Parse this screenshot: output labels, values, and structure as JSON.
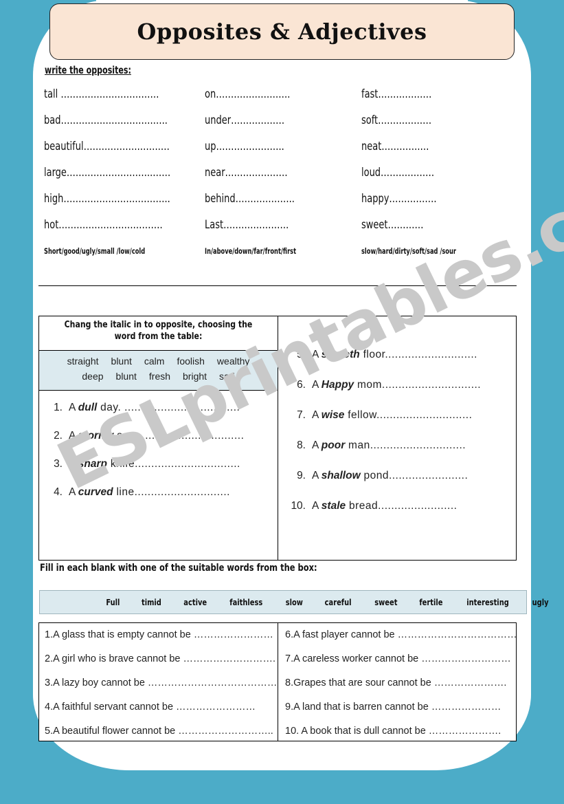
{
  "title": "Opposites & Adjectives",
  "watermark": "ESLprintables.com",
  "colors": {
    "frame": "#4cacc8",
    "title_bg": "#fae5d4",
    "wordbank_bg": "#dceaef",
    "watermark": "#c9c9c9"
  },
  "section1": {
    "heading": "write the opposites:",
    "columns": [
      {
        "items": [
          "tall ……………………………",
          "bad………………………….…..",
          "beautiful……………….…….…",
          "large………………………..……",
          "high…………………….………..",
          "hot…………………….………."
        ],
        "hint": "Short/good/ugly/small /low/cold"
      },
      {
        "items": [
          "on…………………….",
          "under………………",
          "up…………………..",
          "near…………………",
          "behind………………..",
          "Last…………………."
        ],
        "hint": "In/above/down/far/front/first"
      },
      {
        "items": [
          "fast………………",
          "soft………………",
          "neat………….…",
          "loud………………",
          "happy…………….",
          "sweet…………"
        ],
        "hint": "slow/hard/dirty/soft/sad /sour"
      }
    ]
  },
  "section2": {
    "instruction": "Chang the italic in to opposite, choosing the word from the table:",
    "wordbank_rows": [
      [
        "straight",
        "blunt",
        "calm",
        "foolish",
        "wealthy"
      ],
      [
        "deep",
        "blunt",
        "fresh",
        "bright",
        "sad"
      ]
    ],
    "items_left": [
      {
        "num": "1.",
        "pre": "A ",
        "adj": "dull",
        "post": " day. ..................................."
      },
      {
        "num": "2.",
        "pre": "A ",
        "adj": "stormy",
        "post": " sea................................."
      },
      {
        "num": "3.",
        "pre": "A ",
        "adj": "sharp",
        "post": " knife................................"
      },
      {
        "num": "4.",
        "pre": "A ",
        "adj": "curved",
        "post": " line............................."
      }
    ],
    "items_right": [
      {
        "num": "5.",
        "pre": "A ",
        "adj": "smooth",
        "post": " floor............................"
      },
      {
        "num": "6.",
        "pre": "A ",
        "adj": "Happy",
        "post": " mom.............................."
      },
      {
        "num": "7.",
        "pre": "A ",
        "adj": "wise",
        "post": " fellow............................."
      },
      {
        "num": "8.",
        "pre": "A ",
        "adj": "poor",
        "post": " man............................."
      },
      {
        "num": "9.",
        "pre": "A ",
        "adj": "shallow",
        "post": " pond........................"
      },
      {
        "num": "10.",
        "pre": "A ",
        "adj": "stale",
        "post": " bread........................"
      }
    ]
  },
  "section3": {
    "instruction": "Fill in each blank with one of the  suitable words from the box:",
    "wordbank": [
      "Full",
      "timid",
      "active",
      "faithless",
      "slow",
      "careful",
      "sweet",
      "fertile",
      "interesting",
      "ugly"
    ],
    "items_left": [
      "1.A glass that is empty cannot be ……………………",
      "2.A girl who is brave cannot be ……………………….",
      "3.A lazy boy cannot be …………………………………",
      "4.A faithful servant cannot be ……………………",
      "5.A beautiful flower cannot be ……………………….."
    ],
    "items_right": [
      "6.A fast player cannot be ………………………………",
      "7.A careless worker cannot be ………………………",
      "8.Grapes that are sour cannot be ………………….",
      "9.A land that is barren cannot be …………………",
      "10. A book that is dull cannot be …………………."
    ]
  }
}
